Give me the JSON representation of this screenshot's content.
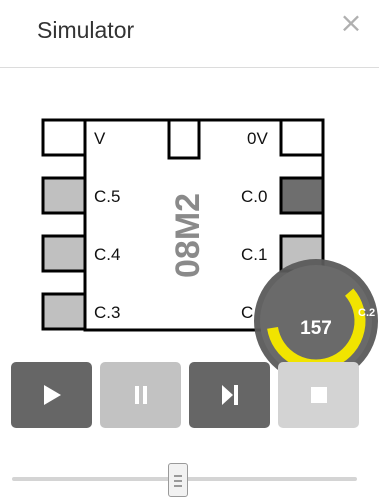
{
  "header": {
    "title": "Simulator",
    "close_label": "×"
  },
  "chip": {
    "name": "08M2",
    "pins": [
      {
        "label": "V",
        "state": "off"
      },
      {
        "label": "C.5",
        "state": "low"
      },
      {
        "label": "C.4",
        "state": "low"
      },
      {
        "label": "C.3",
        "state": "low"
      },
      {
        "label": "0V",
        "state": "off"
      },
      {
        "label": "C.0",
        "state": "high"
      },
      {
        "label": "C.1",
        "state": "low"
      },
      {
        "label": "C",
        "state": "low"
      }
    ],
    "top_pin_state": "off"
  },
  "gauge": {
    "value": "157",
    "label": "C.2",
    "fraction": 0.62,
    "color": "#f1e400"
  },
  "controls": {
    "play_icon": "play-icon",
    "pause_icon": "pause-icon",
    "step_icon": "step-icon",
    "stop_icon": "stop-icon"
  },
  "speed_slider": {
    "level": 0.48
  },
  "colors": {
    "pin_low": "#c0c0c0",
    "pin_high": "#6e6e6e",
    "pin_off": "#ffffff",
    "button_dark": "#666666",
    "button_light": "#c2c2c2",
    "gauge_bg": "#555555"
  }
}
